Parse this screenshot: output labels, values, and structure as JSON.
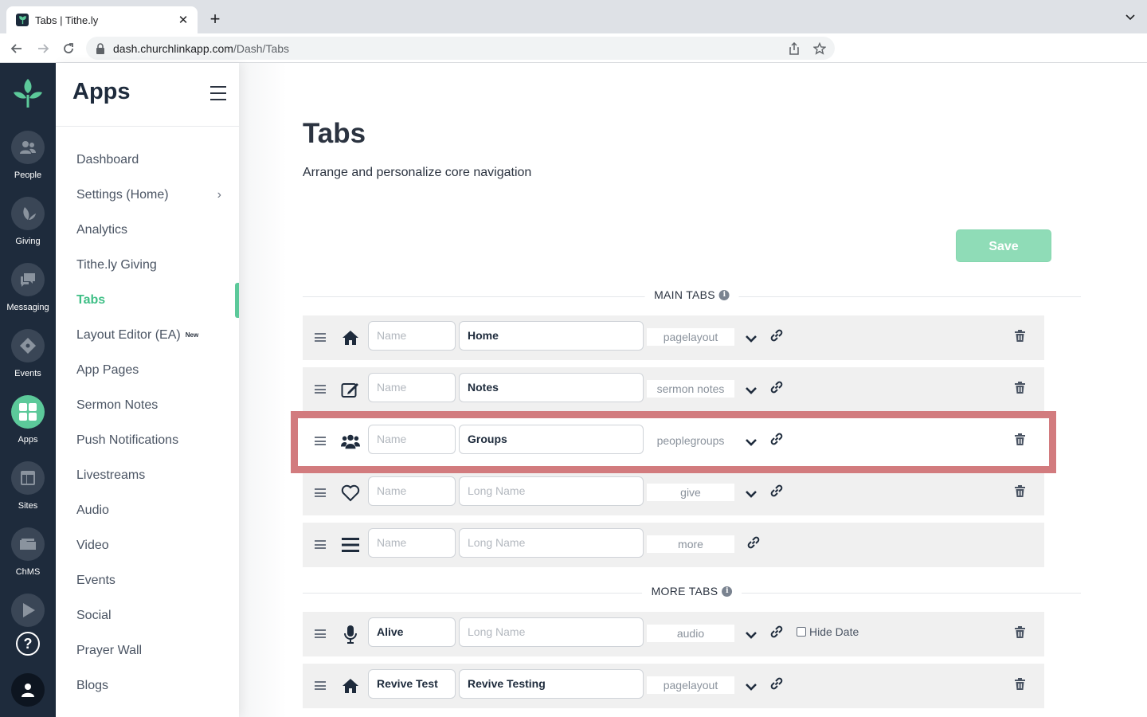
{
  "browser": {
    "tab_title": "Tabs | Tithe.ly",
    "close_glyph": "✕",
    "newtab_glyph": "+",
    "url_host": "dash.churchlinkapp.com",
    "url_path": "/Dash/Tabs"
  },
  "rail": {
    "items": [
      {
        "label": "People",
        "icon": "people-icon"
      },
      {
        "label": "Giving",
        "icon": "leaf-icon"
      },
      {
        "label": "Messaging",
        "icon": "chat-icon"
      },
      {
        "label": "Events",
        "icon": "ticket-icon"
      },
      {
        "label": "Apps",
        "icon": "apps-grid-icon",
        "active": true
      },
      {
        "label": "Sites",
        "icon": "sites-icon"
      },
      {
        "label": "ChMS",
        "icon": "folder-icon"
      }
    ],
    "help_glyph": "?"
  },
  "sidebar": {
    "title": "Apps",
    "items": [
      {
        "label": "Dashboard"
      },
      {
        "label": "Settings (Home)",
        "chevron": "›"
      },
      {
        "label": "Analytics"
      },
      {
        "label": "Tithe.ly Giving"
      },
      {
        "label": "Tabs",
        "active": true
      },
      {
        "label": "Layout Editor (EA)",
        "badge": "New"
      },
      {
        "label": "App Pages"
      },
      {
        "label": "Sermon Notes"
      },
      {
        "label": "Push Notifications"
      },
      {
        "label": "Livestreams"
      },
      {
        "label": "Audio"
      },
      {
        "label": "Video"
      },
      {
        "label": "Events"
      },
      {
        "label": "Social"
      },
      {
        "label": "Prayer Wall"
      },
      {
        "label": "Blogs"
      }
    ]
  },
  "main": {
    "title": "Tabs",
    "subtitle": "Arrange and personalize core navigation",
    "save_label": "Save",
    "main_tabs_label": "MAIN TABS",
    "more_tabs_label": "MORE TABS",
    "info_glyph": "i",
    "main_tabs": [
      {
        "icon": "home-icon",
        "name_placeholder": "Name",
        "name": "",
        "long_name": "Home",
        "long_placeholder": "Long Name",
        "type": "pagelayout",
        "has_dropdown": true,
        "has_trash": true
      },
      {
        "icon": "edit-note-icon",
        "name_placeholder": "Name",
        "name": "",
        "long_name": "Notes",
        "long_placeholder": "Long Name",
        "type": "sermon notes",
        "has_dropdown": true,
        "has_trash": true
      },
      {
        "icon": "groups-icon",
        "name_placeholder": "Name",
        "name": "",
        "long_name": "Groups",
        "long_placeholder": "Long Name",
        "type": "peoplegroups",
        "has_dropdown": true,
        "has_trash": true,
        "highlighted": true
      },
      {
        "icon": "heart-icon",
        "name_placeholder": "Name",
        "name": "",
        "long_name": "",
        "long_placeholder": "Long Name",
        "type": "give",
        "has_dropdown": true,
        "has_trash": true
      },
      {
        "icon": "menu-icon",
        "name_placeholder": "Name",
        "name": "",
        "long_name": "",
        "long_placeholder": "Long Name",
        "type": "more",
        "has_dropdown": false,
        "has_trash": false
      }
    ],
    "more_tabs": [
      {
        "icon": "microphone-icon",
        "name": "Alive",
        "long_name": "",
        "long_placeholder": "Long Name",
        "type": "audio",
        "hide_date_label": "Hide Date"
      },
      {
        "icon": "home-icon",
        "name": "Revive Test",
        "long_name": "Revive Testing",
        "long_placeholder": "Long Name",
        "type": "pagelayout"
      }
    ]
  },
  "colors": {
    "rail_bg": "#1e2b3c",
    "accent": "#5cc99a",
    "save_bg": "#8fdcb7",
    "highlight": "#d27b7e"
  }
}
